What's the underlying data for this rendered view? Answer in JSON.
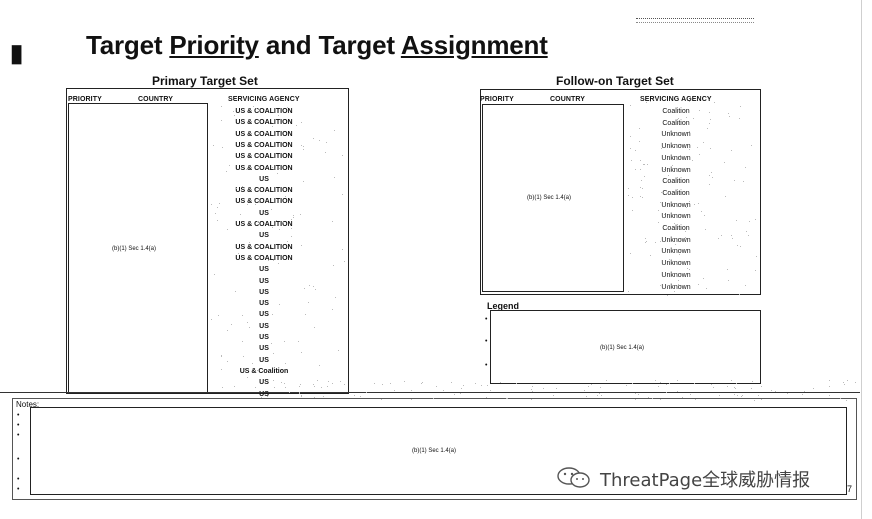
{
  "header": {
    "title_part1": "Target ",
    "title_part2": "Priority",
    "title_part3": " and Target ",
    "title_part4": "Assignment"
  },
  "primary": {
    "label": "Primary Target Set",
    "col_priority": "PRIORITY",
    "col_country": "COUNTRY",
    "col_agency": "SERVICING AGENCY",
    "classification": "(b)(1) Sec 1.4(a)",
    "agencies": [
      "US & COALITION",
      "US & COALITION",
      "US & COALITION",
      "US & COALITION",
      "US & COALITION",
      "US & COALITION",
      "US",
      "US & COALITION",
      "US & COALITION",
      "US",
      "US & COALITION",
      "US",
      "US & COALITION",
      "US & COALITION",
      "US",
      "US",
      "US",
      "US",
      "US",
      "US",
      "US",
      "US",
      "US",
      "US & Coalition",
      "US",
      "US"
    ]
  },
  "followon": {
    "label": "Follow-on Target Set",
    "col_priority": "PRIORITY",
    "col_country": "COUNTRY",
    "col_agency": "SERVICING AGENCY",
    "classification": "(b)(1) Sec 1.4(a)",
    "agencies": [
      "Coalition",
      "Coalition",
      "Unknown",
      "Unknown",
      "Unknown",
      "Unknown",
      "Coalition",
      "Coalition",
      "Unknown",
      "Unknown",
      "Coalition",
      "Unknown",
      "Unknown",
      "Unknown",
      "Unknown",
      "Unknown"
    ]
  },
  "legend": {
    "label": "Legend",
    "classification": "(b)(1) Sec 1.4(a)",
    "bullet": "•"
  },
  "notes": {
    "label": "Notes:",
    "classification": "(b)(1) Sec 1.4(a)",
    "bullet": "•"
  },
  "footer": {
    "page_number": "7",
    "watermark": "ThreatPage全球威胁情报"
  }
}
